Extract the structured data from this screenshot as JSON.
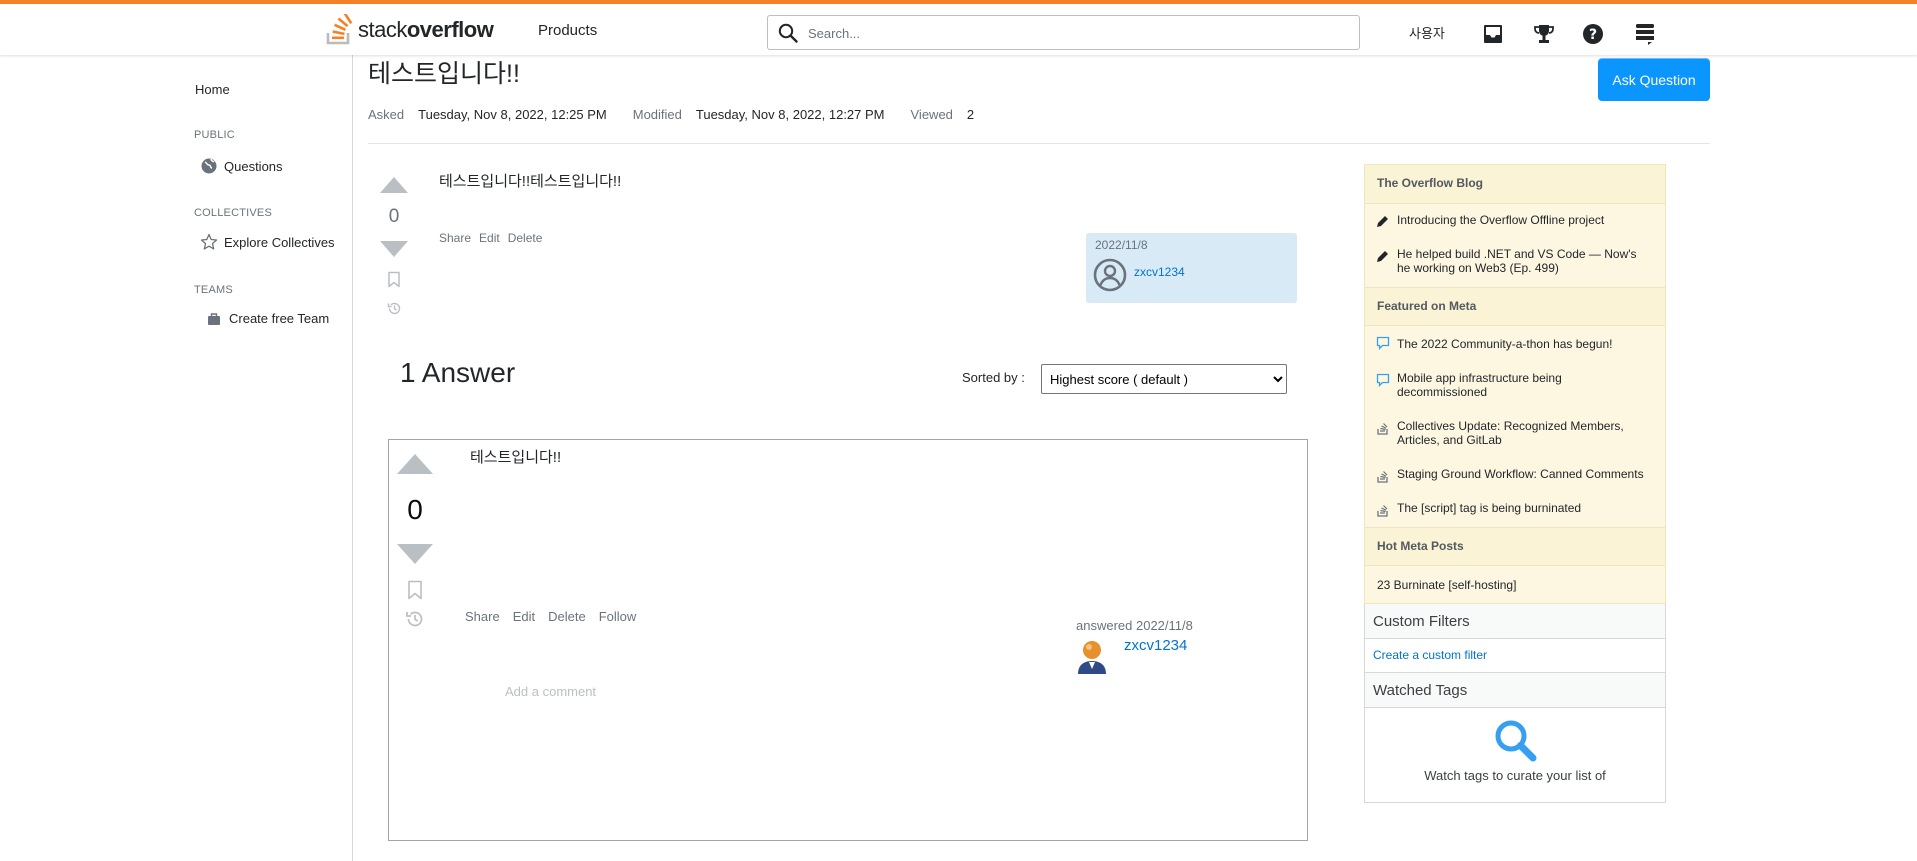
{
  "header": {
    "logo_light": "stack",
    "logo_bold": "overflow",
    "products_label": "Products",
    "search_placeholder": "Search...",
    "user_label": "사용자"
  },
  "leftnav": {
    "home": "Home",
    "public_heading": "PUBLIC",
    "questions": "Questions",
    "collectives_heading": "COLLECTIVES",
    "explore_collectives": "Explore Collectives",
    "teams_heading": "TEAMS",
    "create_team": "Create free Team"
  },
  "question": {
    "title": "테스트입니다!!",
    "ask_button": "Ask Question",
    "asked_label": "Asked",
    "asked_value": "Tuesday, Nov 8, 2022, 12:25 PM",
    "modified_label": "Modified",
    "modified_value": "Tuesday, Nov 8, 2022, 12:27 PM",
    "viewed_label": "Viewed",
    "viewed_value": "2",
    "score": "0",
    "body": "테스트입니다!!테스트입니다!!",
    "menu": [
      "Share",
      "Edit",
      "Delete"
    ],
    "owner_date": "2022/11/8",
    "owner_name": "zxcv1234"
  },
  "answers": {
    "heading": "1 Answer",
    "sorted_label": "Sorted by :",
    "sorted_value": "Highest score ( default )",
    "items": [
      {
        "score": "0",
        "body": "테스트입니다!!",
        "menu": [
          "Share",
          "Edit",
          "Delete",
          "Follow"
        ],
        "answered": "answered 2022/11/8",
        "user": "zxcv1234",
        "add_comment": "Add a comment"
      }
    ]
  },
  "sidebar": {
    "blog_heading": "The Overflow Blog",
    "blog_items": [
      "Introducing the Overflow Offline project",
      "He helped build .NET and VS Code — Now's he working on Web3 (Ep. 499)"
    ],
    "meta_heading": "Featured on Meta",
    "meta_items": [
      "The 2022 Community-a-thon has begun!",
      "Mobile app infrastructure being decommissioned",
      "Collectives Update: Recognized Members, Articles, and GitLab",
      "Staging Ground Workflow: Canned Comments",
      "The [script] tag is being burninated"
    ],
    "hot_heading": "Hot Meta Posts",
    "hot_items": [
      "23 Burninate [self-hosting]"
    ],
    "custom_filters_heading": "Custom Filters",
    "custom_filters_link": "Create a custom filter",
    "watched_tags_heading": "Watched Tags",
    "watched_tags_text": "Watch tags to curate your list of"
  },
  "colors": {
    "accent_orange": "#f48225",
    "primary_blue": "#0a95ff",
    "link_blue": "#0074cc",
    "blog_bg": "#fdf7e2"
  }
}
